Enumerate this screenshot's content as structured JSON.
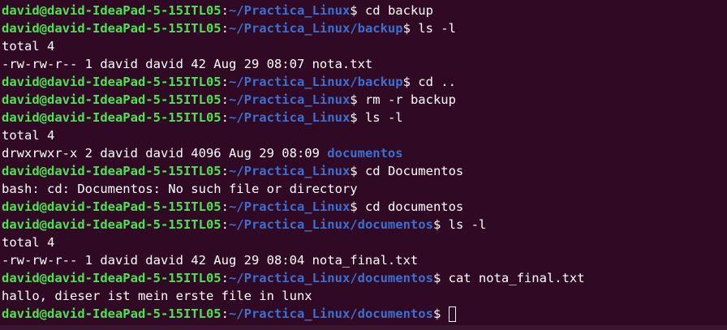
{
  "terminal": {
    "prompt_user": "david@david-IdeaPad-5-15ITL05",
    "lines": [
      {
        "type": "prompt",
        "path": "~/Practica_Linux",
        "cmd": "cd backup"
      },
      {
        "type": "prompt",
        "path": "~/Practica_Linux/backup",
        "cmd": "ls -l"
      },
      {
        "type": "output",
        "text": "total 4"
      },
      {
        "type": "output",
        "text": "-rw-rw-r-- 1 david david 42 Aug 29 08:07 nota.txt"
      },
      {
        "type": "prompt",
        "path": "~/Practica_Linux/backup",
        "cmd": "cd .."
      },
      {
        "type": "prompt",
        "path": "~/Practica_Linux",
        "cmd": "rm -r backup"
      },
      {
        "type": "prompt",
        "path": "~/Practica_Linux",
        "cmd": "ls -l"
      },
      {
        "type": "output",
        "text": "total 4"
      },
      {
        "type": "listing",
        "text": "drwxrwxr-x 2 david david 4096 Aug 29 08:09 ",
        "dir": "documentos"
      },
      {
        "type": "prompt",
        "path": "~/Practica_Linux",
        "cmd": "cd Documentos"
      },
      {
        "type": "output",
        "text": "bash: cd: Documentos: No such file or directory"
      },
      {
        "type": "prompt",
        "path": "~/Practica_Linux",
        "cmd": "cd documentos"
      },
      {
        "type": "prompt",
        "path": "~/Practica_Linux/documentos",
        "cmd": "ls -l"
      },
      {
        "type": "output",
        "text": "total 4"
      },
      {
        "type": "output",
        "text": "-rw-rw-r-- 1 david david 42 Aug 29 08:04 nota_final.txt"
      },
      {
        "type": "prompt",
        "path": "~/Practica_Linux/documentos",
        "cmd": "cat nota_final.txt"
      },
      {
        "type": "output",
        "text": "hallo, dieser ist mein erste file in lunx"
      },
      {
        "type": "prompt",
        "path": "~/Practica_Linux/documentos",
        "cmd": "",
        "cursor": true
      }
    ]
  },
  "colors": {
    "background": "#300a24",
    "user": "#4ee34e",
    "path": "#3b6fd0",
    "text": "#ffffff"
  }
}
